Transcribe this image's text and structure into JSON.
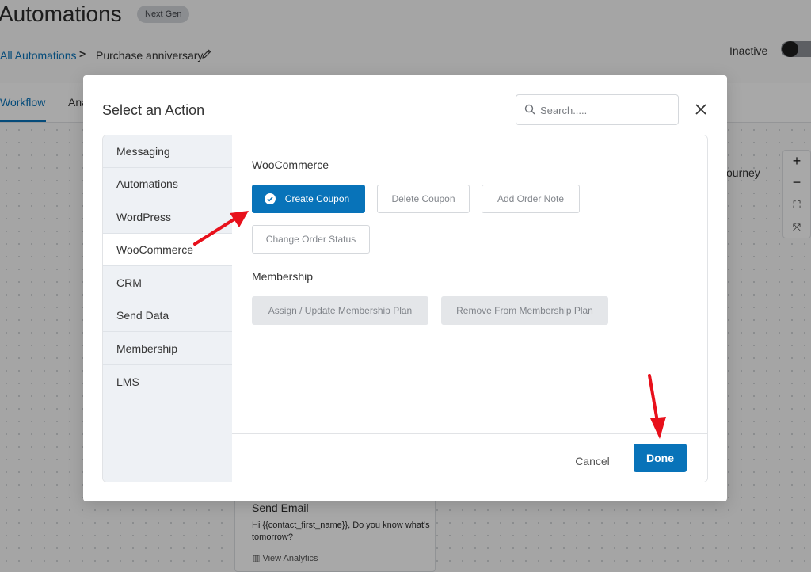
{
  "header": {
    "title": "Automations",
    "badge": "Next Gen",
    "status_label": "Inactive"
  },
  "breadcrumb": {
    "root": "All Automations",
    "separator": ">",
    "current": "Purchase anniversary"
  },
  "tabs": [
    {
      "label": "Workflow",
      "active": true
    },
    {
      "label": "Ana",
      "active": false
    }
  ],
  "canvas": {
    "journey_label": "ourney",
    "zoom": [
      "+",
      "−",
      "⛶",
      "⤧"
    ],
    "node": {
      "title": "Send Email",
      "text": "Hi {{contact_first_name}}, Do you know what's tomorrow?",
      "analytics_label": "View Analytics"
    }
  },
  "modal": {
    "title": "Select an Action",
    "search_placeholder": "Search.....",
    "categories": [
      {
        "label": "Messaging",
        "active": false
      },
      {
        "label": "Automations",
        "active": false
      },
      {
        "label": "WordPress",
        "active": false
      },
      {
        "label": "WooCommerce",
        "active": true
      },
      {
        "label": "CRM",
        "active": false
      },
      {
        "label": "Send Data",
        "active": false
      },
      {
        "label": "Membership",
        "active": false
      },
      {
        "label": "LMS",
        "active": false
      }
    ],
    "sections": [
      {
        "label": "WooCommerce",
        "actions": [
          {
            "label": "Create Coupon",
            "state": "selected"
          },
          {
            "label": "Delete Coupon",
            "state": "default"
          },
          {
            "label": "Add Order Note",
            "state": "default"
          },
          {
            "label": "Change Order Status",
            "state": "default"
          }
        ]
      },
      {
        "label": "Membership",
        "actions": [
          {
            "label": "Assign / Update Membership Plan",
            "state": "disabled"
          },
          {
            "label": "Remove From Membership Plan",
            "state": "disabled"
          }
        ]
      }
    ],
    "cancel_label": "Cancel",
    "done_label": "Done"
  },
  "colors": {
    "primary": "#0873b9",
    "annotation_arrow": "#e8101b",
    "sidebar_bg": "#eef1f5"
  }
}
